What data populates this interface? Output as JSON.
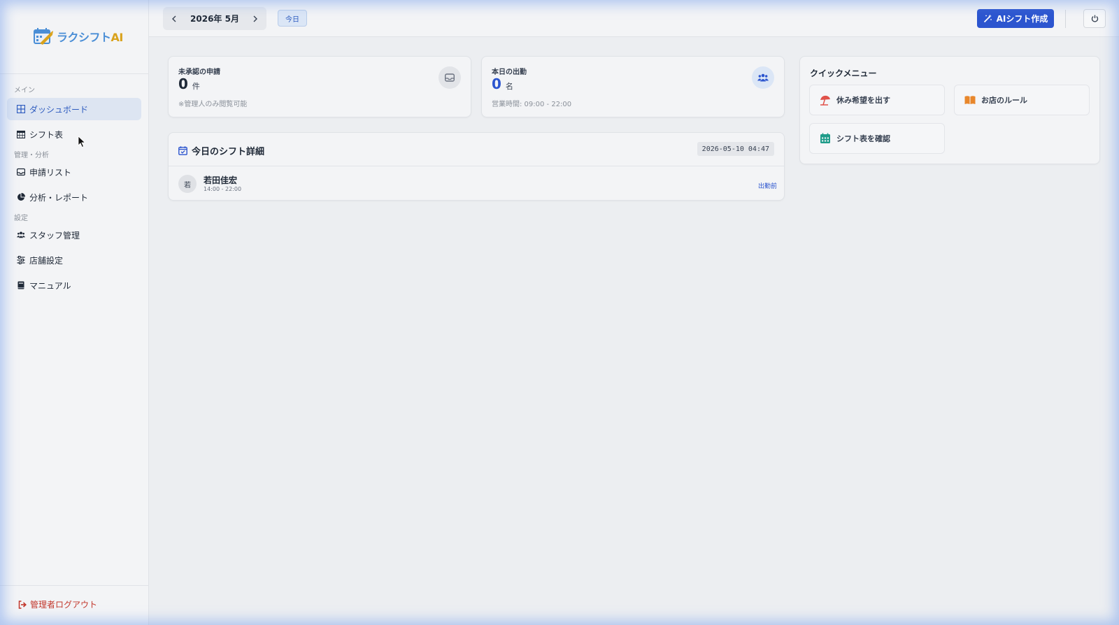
{
  "app": {
    "logo_text": "ラクシフト",
    "logo_suffix": "AI"
  },
  "sidebar": {
    "sections": {
      "main": "メイン",
      "manage": "管理・分析",
      "settings": "設定"
    },
    "items": [
      {
        "label": "ダッシュボード",
        "icon": "grid-icon",
        "active": true
      },
      {
        "label": "シフト表",
        "icon": "calendar-icon"
      },
      {
        "label": "申請リスト",
        "icon": "inbox-icon"
      },
      {
        "label": "分析・レポート",
        "icon": "pie-chart-icon"
      },
      {
        "label": "スタッフ管理",
        "icon": "users-icon"
      },
      {
        "label": "店舗設定",
        "icon": "sliders-icon"
      },
      {
        "label": "マニュアル",
        "icon": "book-icon"
      }
    ],
    "logout": "管理者ログアウト"
  },
  "topbar": {
    "month": "2026年 5月",
    "today": "今日",
    "ai_button": "AIシフト作成"
  },
  "stats": {
    "pending": {
      "title": "未承認の申請",
      "value": "0",
      "unit": "件",
      "note": "※管理人のみ閲覧可能"
    },
    "attendance": {
      "title": "本日の出勤",
      "value": "0",
      "unit": "名",
      "note": "営業時間: 09:00 - 22:00"
    }
  },
  "shift_detail": {
    "title": "今日のシフト詳細",
    "timestamp": "2026-05-10 04:47",
    "staff": [
      {
        "initial": "若",
        "name": "若田佳宏",
        "time": "14:00 - 22:00",
        "status": "出勤前"
      }
    ]
  },
  "quick_menu": {
    "title": "クイックメニュー",
    "items": [
      {
        "label": "休み希望を出す",
        "icon": "beach-umbrella-icon"
      },
      {
        "label": "お店のルール",
        "icon": "open-book-icon"
      },
      {
        "label": "シフト表を確認",
        "icon": "calendar-grid-icon"
      }
    ]
  },
  "colors": {
    "accent": "#2c55cf",
    "logout": "#c2362b",
    "vacation_icon": "#e0524a",
    "rules_icon": "#e8872b",
    "calendar_icon": "#1f9c8a"
  }
}
